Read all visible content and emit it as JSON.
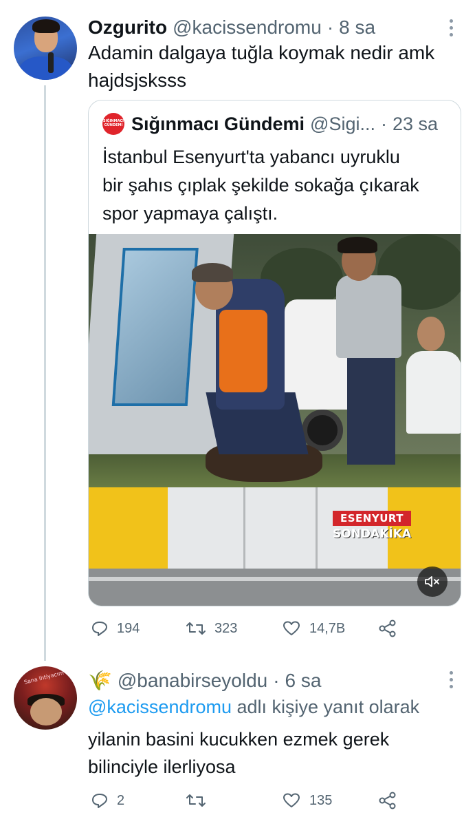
{
  "tweet1": {
    "name": "Ozgurito",
    "handle": "@kacissendromu",
    "separator": "·",
    "time": "8 sa",
    "text_line1": "Adamin dalgaya tuğla koymak nedir amk",
    "text_line2": "hajdsjsksss",
    "avatar_icon": "profile-photo",
    "quote": {
      "name": "Sığınmacı Gündemi",
      "handle": "@Sigi...",
      "separator": "·",
      "time": "23 sa",
      "logo_text": "SIĞINMACI GÜNDEMİ",
      "text_line1": "İstanbul Esenyurt'ta yabancı uyruklu",
      "text_line2": "bir şahıs çıplak şekilde sokağa çıkarak",
      "text_line3": "spor yapmaya çalıştı.",
      "watermark_line1": "ESENYURT",
      "watermark_line2": "SONDAKİKA",
      "mute_icon": "volume-muted-icon"
    },
    "actions": {
      "replies": "194",
      "retweets": "323",
      "likes": "14,7B"
    }
  },
  "tweet2": {
    "emoji": "🌾",
    "handle": "@banabirseyoldu",
    "separator": "·",
    "time": "6 sa",
    "reply_to_handle": "@kacissendromu",
    "reply_to_suffix": " adlı kişiye yanıt olarak",
    "text_line1": "yilanin basini kucukken ezmek gerek",
    "text_line2": "bilinciyle ilerliyosa",
    "avatar_text": "Sana ihtiyacım var",
    "actions": {
      "replies": "2",
      "retweets": "",
      "likes": "135"
    }
  },
  "colors": {
    "text": "#0f1419",
    "secondary": "#536471",
    "link": "#1d9bf0",
    "border": "#cfd9de",
    "logo_red": "#e0242b"
  }
}
